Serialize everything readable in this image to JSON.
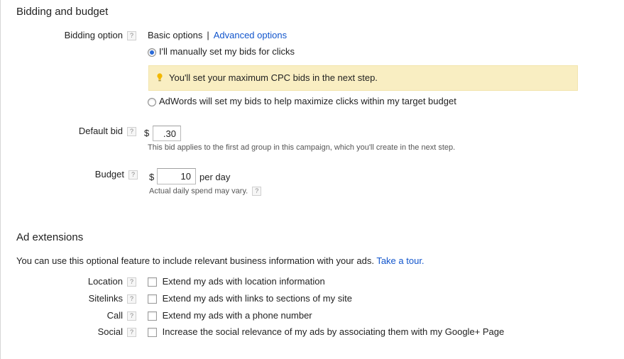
{
  "bidding": {
    "title": "Bidding and budget",
    "option_label": "Bidding option",
    "help": "?",
    "basic_options": "Basic options",
    "separator": "|",
    "advanced_options": "Advanced options",
    "radio_manual_label": "I'll manually set my bids for clicks",
    "radio_manual_checked": true,
    "info_text": "You'll set your maximum CPC bids in the next step.",
    "radio_auto_label": "AdWords will set my bids to help maximize clicks within my target budget",
    "radio_auto_checked": false,
    "default_bid_label": "Default bid",
    "currency": "$",
    "default_bid_value": ".30",
    "default_bid_note": "This bid applies to the first ad group in this campaign, which you'll create in the next step.",
    "budget_label": "Budget",
    "budget_value": "10",
    "budget_suffix": "per day",
    "budget_note": "Actual daily spend may vary."
  },
  "extensions": {
    "title": "Ad extensions",
    "intro": "You can use this optional feature to include relevant business information with your ads.",
    "tour_link": "Take a tour.",
    "items": [
      {
        "label": "Location",
        "text": "Extend my ads with location information",
        "checked": false
      },
      {
        "label": "Sitelinks",
        "text": "Extend my ads with links to sections of my site",
        "checked": false
      },
      {
        "label": "Call",
        "text": "Extend my ads with a phone number",
        "checked": false
      },
      {
        "label": "Social",
        "text": "Increase the social relevance of my ads by associating them with my Google+ Page",
        "checked": false
      }
    ]
  },
  "icons": {
    "help": "help-icon",
    "bulb": "lightbulb-icon"
  },
  "colors": {
    "link": "#1155cc",
    "info_bg": "#f9eec2",
    "radio_selected": "#2a6ad8"
  }
}
